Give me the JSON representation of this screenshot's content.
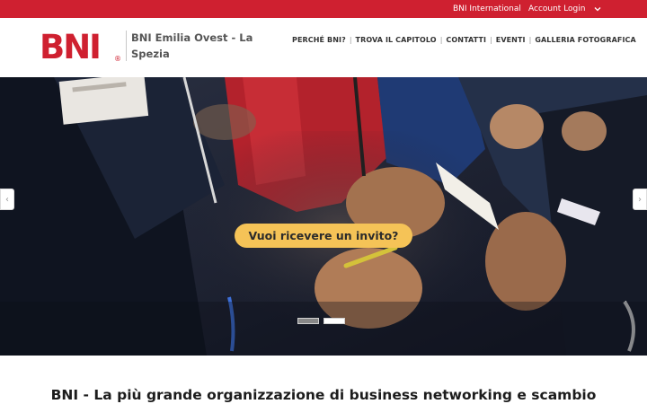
{
  "topbar": {
    "international_label": "BNI International",
    "account_label": "Account Login",
    "account_icon": "chevron-down-icon"
  },
  "header": {
    "logo_text": "BNI",
    "logo_mark": "®",
    "chapter_name": "BNI Emilia Ovest - La Spezia",
    "nav": [
      {
        "label": "PERCHÉ BNI?"
      },
      {
        "label": "TROVA IL CAPITOLO"
      },
      {
        "label": "CONTATTI"
      },
      {
        "label": "EVENTI"
      },
      {
        "label": "GALLERIA FOTOGRAFICA"
      }
    ],
    "nav_separator": "|"
  },
  "hero": {
    "cta_label": "Vuoi ricevere un invito?",
    "prev_icon": "chevron-left-icon",
    "next_icon": "chevron-right-icon",
    "prev_glyph": "‹",
    "next_glyph": "›",
    "slides_total": 2,
    "active_slide": 2
  },
  "main": {
    "headline": "BNI - La più grande organizzazione di business networking e scambio"
  },
  "colors": {
    "brand_red": "#cf2030",
    "cta_yellow": "#f5c357",
    "hero_dark": "#1a1f2e"
  }
}
